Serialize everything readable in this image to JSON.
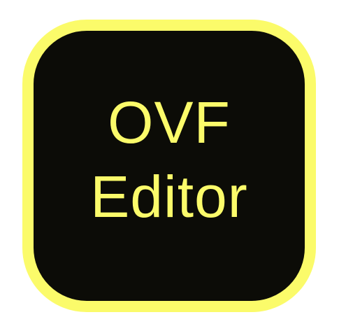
{
  "icon": {
    "line1": "OVF",
    "line2": "Editor",
    "colors": {
      "accent": "#fbfb6a",
      "background": "#0c0c07"
    }
  }
}
